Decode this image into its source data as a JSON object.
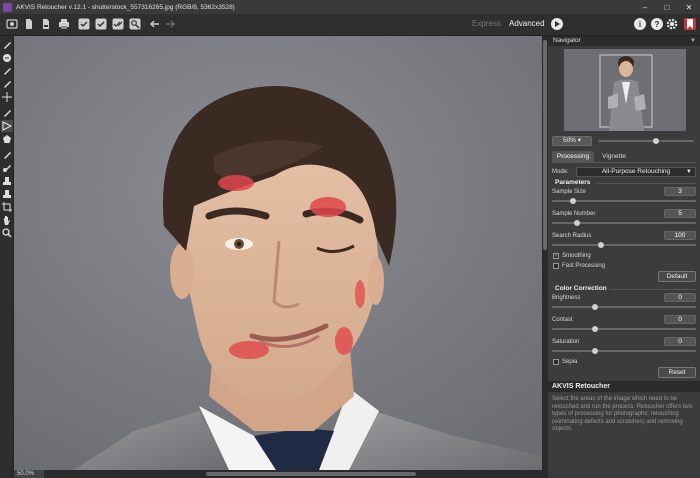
{
  "window": {
    "title": "AKVIS Retoucher v.12.1 - shutterstock_557316265.jpg (RGB/8, 5362x3528)"
  },
  "toolbar": {
    "mode_express": "Express",
    "mode_advanced": "Advanced"
  },
  "canvas": {
    "zoom_readout": "50.0%"
  },
  "navigator": {
    "header": "Navigator",
    "zoom_value": "50%",
    "zoom_slider_fraction": 0.6
  },
  "tabs": [
    {
      "label": "Processing",
      "active": true
    },
    {
      "label": "Vignette",
      "active": false
    }
  ],
  "processing": {
    "mode_label": "Mode:",
    "mode_value": "All-Purpose Retouching",
    "parameters_title": "Parameters",
    "params": [
      {
        "label": "Sample Size",
        "value": "3",
        "fraction": 0.05
      },
      {
        "label": "Sample Number",
        "value": "5",
        "fraction": 0.1
      },
      {
        "label": "Search Radius",
        "value": "100",
        "fraction": 0.4
      }
    ],
    "smoothing_label": "Smoothing",
    "smoothing_checked": true,
    "fast_processing_label": "Fast Processing",
    "fast_processing_checked": false,
    "default_button": "Default",
    "color_correction_title": "Color Correction",
    "color": [
      {
        "label": "Brightness",
        "value": "0",
        "fraction": 0.5
      },
      {
        "label": "Contast",
        "value": "0",
        "fraction": 0.5
      },
      {
        "label": "Saturation",
        "value": "0",
        "fraction": 0.5
      }
    ],
    "sepia_label": "Sepia",
    "sepia_checked": false,
    "reset_button": "Reset"
  },
  "help": {
    "title": "AKVIS Retoucher",
    "text": "Select the areas of the image which need to be retouched and run the process. Retoucher offers two types of processing for photographs: retouching (eliminating defects and scratches) and removing objects."
  },
  "colors": {
    "accent_red": "#e0474c",
    "panel_bg": "#3c3c3c",
    "canvas_bg": "#7a7c82"
  }
}
